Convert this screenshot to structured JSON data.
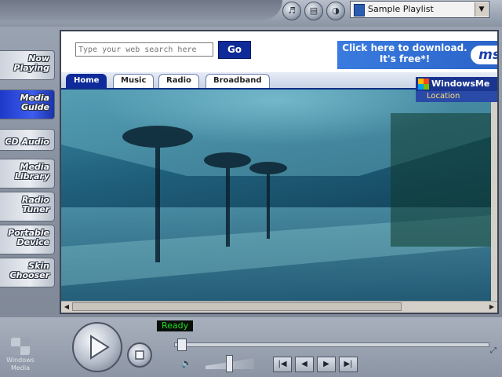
{
  "toolbar": {
    "playlist_value": "Sample Playlist",
    "icons": [
      "shuffle-icon",
      "playlist-icon",
      "equalizer-icon"
    ]
  },
  "sidebar": {
    "items": [
      {
        "label": "Now Playing",
        "active": false
      },
      {
        "label": "Media Guide",
        "active": true
      },
      {
        "label": "CD Audio",
        "active": false
      },
      {
        "label": "Media Library",
        "active": false
      },
      {
        "label": "Radio Tuner",
        "active": false
      },
      {
        "label": "Portable Device",
        "active": false
      },
      {
        "label": "Skin Chooser",
        "active": false
      }
    ]
  },
  "guide": {
    "search_placeholder": "Type your web search here",
    "go_label": "Go",
    "banner_text": "Click here to download. It's free*!",
    "banner_logo": "ms",
    "tabs": [
      {
        "label": "Home",
        "active": true
      },
      {
        "label": "Music",
        "active": false
      },
      {
        "label": "Radio",
        "active": false
      },
      {
        "label": "Broadband",
        "active": false
      }
    ],
    "wm_logo_text": "WindowsMe",
    "location_label": "Location"
  },
  "status": {
    "text": "Ready"
  },
  "brand": {
    "logo_text": "Windows Media"
  },
  "colors": {
    "accent": "#0f2b9a",
    "status": "#22dd22"
  }
}
